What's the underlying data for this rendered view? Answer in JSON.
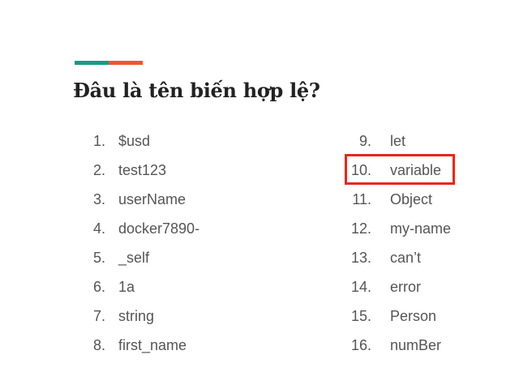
{
  "slide": {
    "title": "Đâu là tên biến hợp lệ?",
    "accent_colors": [
      "#1a9a84",
      "#ec5a2a"
    ],
    "highlight_color": "#e8271c",
    "left_items": [
      {
        "num": "1.",
        "name": "$usd"
      },
      {
        "num": "2.",
        "name": "test123"
      },
      {
        "num": "3.",
        "name": "userName"
      },
      {
        "num": "4.",
        "name": "docker7890-"
      },
      {
        "num": "5.",
        "name": "_self"
      },
      {
        "num": "6.",
        "name": "1a"
      },
      {
        "num": "7.",
        "name": "string"
      },
      {
        "num": "8.",
        "name": "first_name"
      }
    ],
    "right_items": [
      {
        "num": "9.",
        "name": "let"
      },
      {
        "num": "10.",
        "name": "variable"
      },
      {
        "num": "11.",
        "name": "Object"
      },
      {
        "num": "12.",
        "name": "my-name"
      },
      {
        "num": "13.",
        "name": "can’t"
      },
      {
        "num": "14.",
        "name": "error"
      },
      {
        "num": "15.",
        "name": "Person"
      },
      {
        "num": "16.",
        "name": "numBer"
      }
    ]
  }
}
